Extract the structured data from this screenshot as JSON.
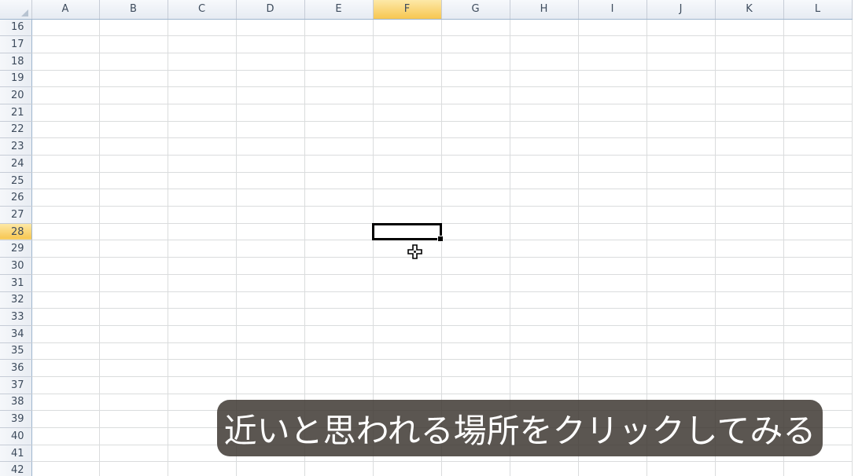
{
  "columns": [
    "A",
    "B",
    "C",
    "D",
    "E",
    "F",
    "G",
    "H",
    "I",
    "J",
    "K",
    "L"
  ],
  "rows": [
    "16",
    "17",
    "18",
    "19",
    "20",
    "21",
    "22",
    "23",
    "24",
    "25",
    "26",
    "27",
    "28",
    "29",
    "30",
    "31",
    "32",
    "33",
    "34",
    "35",
    "36",
    "37",
    "38",
    "39",
    "40",
    "41",
    "42"
  ],
  "active_cell": {
    "column": "F",
    "row": "28"
  },
  "cursor_icon": "cell-select-plus-cursor",
  "caption": {
    "text": "近いと思われる場所をクリックしてみる"
  },
  "colors": {
    "active_header": "#f7c650",
    "gridline": "#dadcdd",
    "caption_background": "#403a34"
  }
}
